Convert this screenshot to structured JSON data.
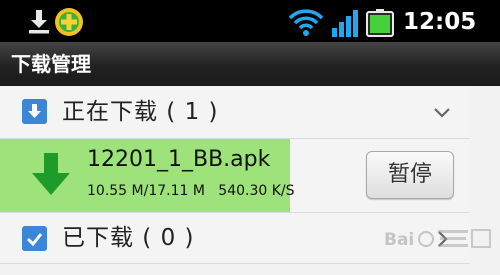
{
  "status_bar": {
    "time": "12:05",
    "icons": [
      "download-icon",
      "app-360-icon",
      "wifi-icon",
      "signal-icon",
      "battery-icon"
    ],
    "accent": "#18a2ef"
  },
  "title_bar": {
    "title": "下载管理"
  },
  "sections": {
    "downloading": {
      "label": "正在下载 ( 1 )",
      "icon": "download-arrow-icon",
      "expanded": true
    },
    "downloaded": {
      "label": "已下载 ( 0 )",
      "icon": "checkbox-icon",
      "expanded": false
    }
  },
  "download_item": {
    "name": "12201_1_BB.apk",
    "stats": "10.55 M/17.11 M   540.30 K/S",
    "progress": 0.617,
    "progress_color": "#9de27a",
    "pause_label": "暂停"
  },
  "watermark": {
    "image": "baidu-jingyan-logo"
  }
}
